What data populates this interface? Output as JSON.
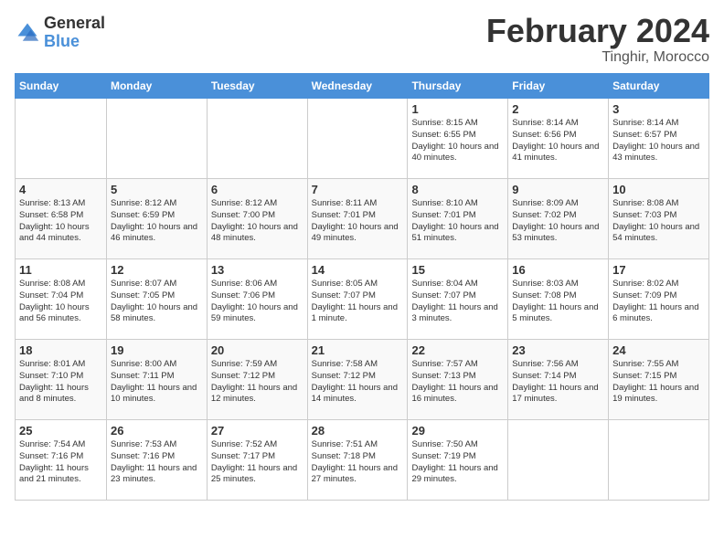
{
  "logo": {
    "general": "General",
    "blue": "Blue"
  },
  "title": "February 2024",
  "subtitle": "Tinghir, Morocco",
  "days_of_week": [
    "Sunday",
    "Monday",
    "Tuesday",
    "Wednesday",
    "Thursday",
    "Friday",
    "Saturday"
  ],
  "weeks": [
    [
      {
        "day": "",
        "info": ""
      },
      {
        "day": "",
        "info": ""
      },
      {
        "day": "",
        "info": ""
      },
      {
        "day": "",
        "info": ""
      },
      {
        "day": "1",
        "info": "Sunrise: 8:15 AM\nSunset: 6:55 PM\nDaylight: 10 hours\nand 40 minutes."
      },
      {
        "day": "2",
        "info": "Sunrise: 8:14 AM\nSunset: 6:56 PM\nDaylight: 10 hours\nand 41 minutes."
      },
      {
        "day": "3",
        "info": "Sunrise: 8:14 AM\nSunset: 6:57 PM\nDaylight: 10 hours\nand 43 minutes."
      }
    ],
    [
      {
        "day": "4",
        "info": "Sunrise: 8:13 AM\nSunset: 6:58 PM\nDaylight: 10 hours\nand 44 minutes."
      },
      {
        "day": "5",
        "info": "Sunrise: 8:12 AM\nSunset: 6:59 PM\nDaylight: 10 hours\nand 46 minutes."
      },
      {
        "day": "6",
        "info": "Sunrise: 8:12 AM\nSunset: 7:00 PM\nDaylight: 10 hours\nand 48 minutes."
      },
      {
        "day": "7",
        "info": "Sunrise: 8:11 AM\nSunset: 7:01 PM\nDaylight: 10 hours\nand 49 minutes."
      },
      {
        "day": "8",
        "info": "Sunrise: 8:10 AM\nSunset: 7:01 PM\nDaylight: 10 hours\nand 51 minutes."
      },
      {
        "day": "9",
        "info": "Sunrise: 8:09 AM\nSunset: 7:02 PM\nDaylight: 10 hours\nand 53 minutes."
      },
      {
        "day": "10",
        "info": "Sunrise: 8:08 AM\nSunset: 7:03 PM\nDaylight: 10 hours\nand 54 minutes."
      }
    ],
    [
      {
        "day": "11",
        "info": "Sunrise: 8:08 AM\nSunset: 7:04 PM\nDaylight: 10 hours\nand 56 minutes."
      },
      {
        "day": "12",
        "info": "Sunrise: 8:07 AM\nSunset: 7:05 PM\nDaylight: 10 hours\nand 58 minutes."
      },
      {
        "day": "13",
        "info": "Sunrise: 8:06 AM\nSunset: 7:06 PM\nDaylight: 10 hours\nand 59 minutes."
      },
      {
        "day": "14",
        "info": "Sunrise: 8:05 AM\nSunset: 7:07 PM\nDaylight: 11 hours\nand 1 minute."
      },
      {
        "day": "15",
        "info": "Sunrise: 8:04 AM\nSunset: 7:07 PM\nDaylight: 11 hours\nand 3 minutes."
      },
      {
        "day": "16",
        "info": "Sunrise: 8:03 AM\nSunset: 7:08 PM\nDaylight: 11 hours\nand 5 minutes."
      },
      {
        "day": "17",
        "info": "Sunrise: 8:02 AM\nSunset: 7:09 PM\nDaylight: 11 hours\nand 6 minutes."
      }
    ],
    [
      {
        "day": "18",
        "info": "Sunrise: 8:01 AM\nSunset: 7:10 PM\nDaylight: 11 hours\nand 8 minutes."
      },
      {
        "day": "19",
        "info": "Sunrise: 8:00 AM\nSunset: 7:11 PM\nDaylight: 11 hours\nand 10 minutes."
      },
      {
        "day": "20",
        "info": "Sunrise: 7:59 AM\nSunset: 7:12 PM\nDaylight: 11 hours\nand 12 minutes."
      },
      {
        "day": "21",
        "info": "Sunrise: 7:58 AM\nSunset: 7:12 PM\nDaylight: 11 hours\nand 14 minutes."
      },
      {
        "day": "22",
        "info": "Sunrise: 7:57 AM\nSunset: 7:13 PM\nDaylight: 11 hours\nand 16 minutes."
      },
      {
        "day": "23",
        "info": "Sunrise: 7:56 AM\nSunset: 7:14 PM\nDaylight: 11 hours\nand 17 minutes."
      },
      {
        "day": "24",
        "info": "Sunrise: 7:55 AM\nSunset: 7:15 PM\nDaylight: 11 hours\nand 19 minutes."
      }
    ],
    [
      {
        "day": "25",
        "info": "Sunrise: 7:54 AM\nSunset: 7:16 PM\nDaylight: 11 hours\nand 21 minutes."
      },
      {
        "day": "26",
        "info": "Sunrise: 7:53 AM\nSunset: 7:16 PM\nDaylight: 11 hours\nand 23 minutes."
      },
      {
        "day": "27",
        "info": "Sunrise: 7:52 AM\nSunset: 7:17 PM\nDaylight: 11 hours\nand 25 minutes."
      },
      {
        "day": "28",
        "info": "Sunrise: 7:51 AM\nSunset: 7:18 PM\nDaylight: 11 hours\nand 27 minutes."
      },
      {
        "day": "29",
        "info": "Sunrise: 7:50 AM\nSunset: 7:19 PM\nDaylight: 11 hours\nand 29 minutes."
      },
      {
        "day": "",
        "info": ""
      },
      {
        "day": "",
        "info": ""
      }
    ]
  ]
}
